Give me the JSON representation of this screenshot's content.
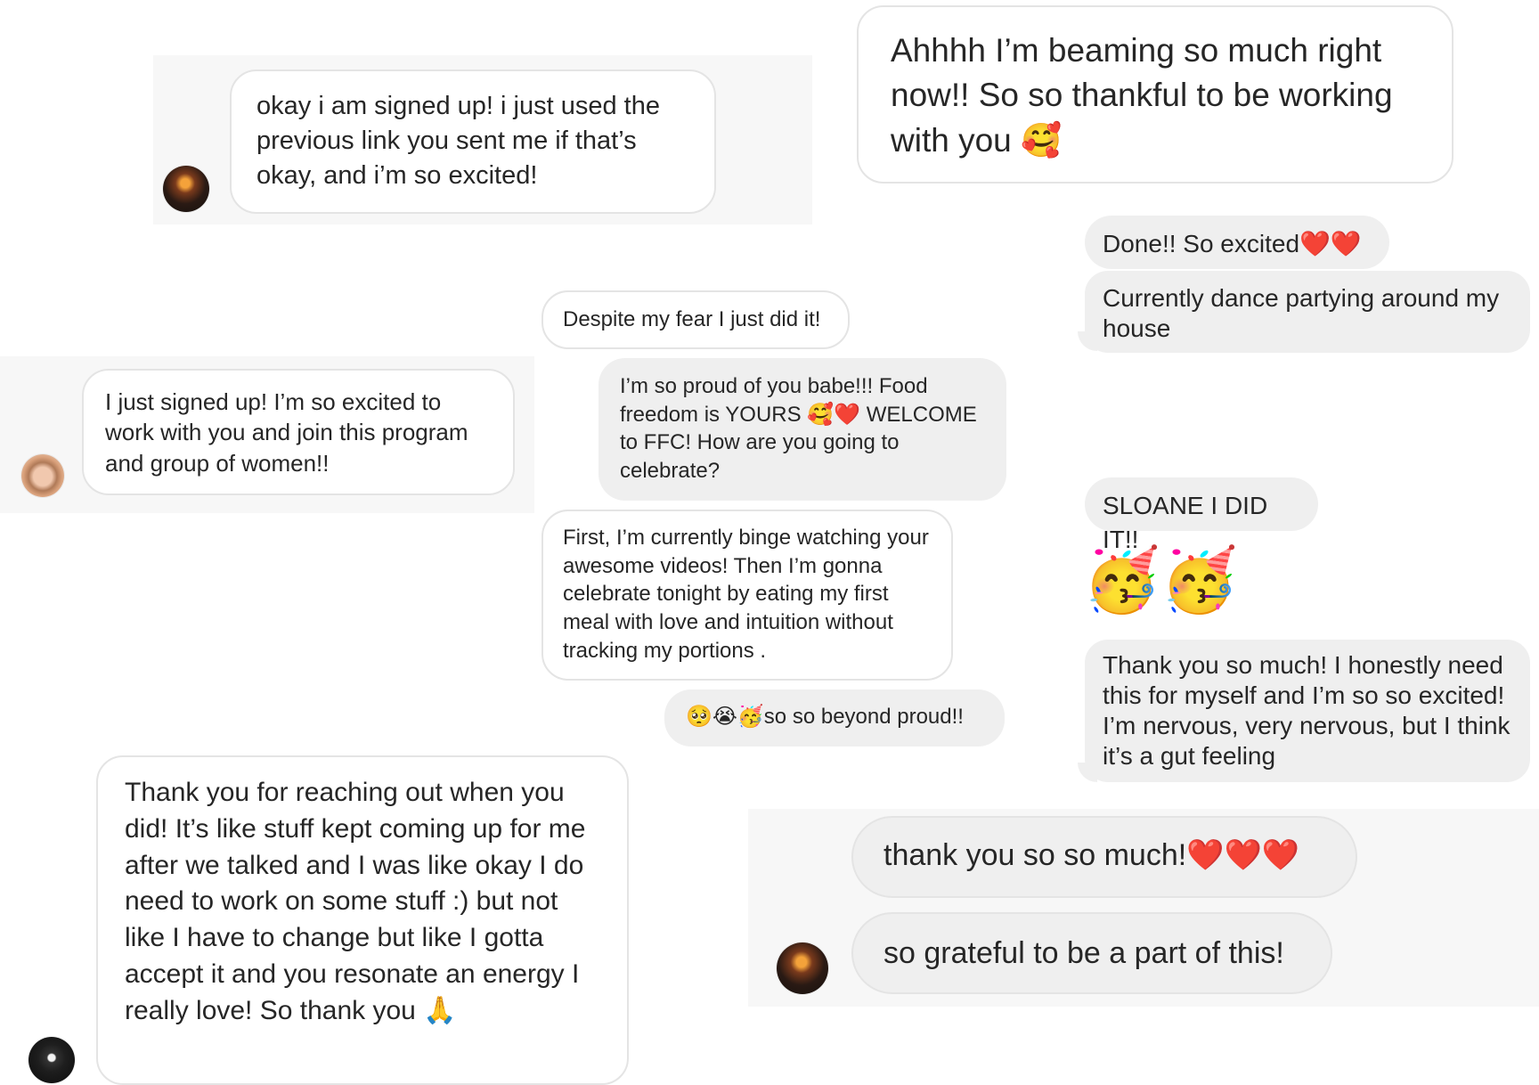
{
  "messages": {
    "m1": "okay i am signed up! i just used the previous link you sent me if that’s okay, and i’m so excited!",
    "m2": "Ahhhh I’m beaming so much right now!! So so thankful to be working with you 🥰",
    "m3": "Done!! So excited❤️❤️",
    "m4": "Currently dance partying around my house",
    "m5": "Despite my fear I just did it!",
    "m6": "I just signed up! I’m so excited to work with you and join this program and group of women!!",
    "m7": "I’m so proud of you babe!!! Food freedom is YOURS 🥰❤️ WELCOME to FFC! How are you going to celebrate?",
    "m8": "SLOANE I DID IT!!",
    "m9": "🥳🥳",
    "m10": "First, I’m currently binge watching your awesome videos! Then I’m gonna celebrate tonight by eating my first meal with love and intuition without tracking my portions .",
    "m11": "Thank you so much! I honestly need this for myself and I’m so so excited! I’m nervous, very nervous, but I think it’s a gut feeling",
    "m12": "🥺😭🥳so so beyond proud!!",
    "m13": "Thank you for reaching out when you did! It’s like stuff kept coming up for me after we talked and I was like okay I do need to work on some stuff :) but not like I have to change but like I gotta accept it and you resonate an energy I really love! So thank you 🙏",
    "m14": "thank you so so much!❤️❤️❤️",
    "m15": "so grateful to be a part of this!"
  },
  "colors": {
    "bubble_border": "#e4e4e4",
    "bubble_grey": "#efefef",
    "text": "#262626",
    "background": "#ffffff"
  }
}
